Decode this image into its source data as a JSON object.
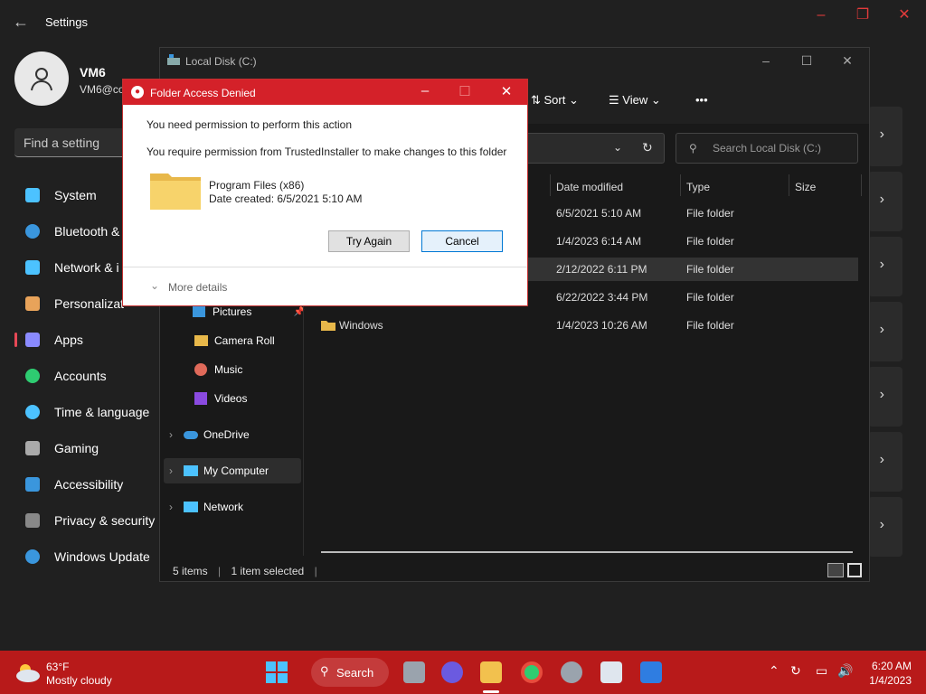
{
  "settings": {
    "title": "Settings",
    "user_name": "VM6",
    "user_email": "VM6@co",
    "search_placeholder": "Find a setting",
    "nav": [
      {
        "label": "System",
        "color": "#4cc2ff"
      },
      {
        "label": "Bluetooth &",
        "color": "#3a96dd"
      },
      {
        "label": "Network & i",
        "color": "#4cc2ff"
      },
      {
        "label": "Personalizat",
        "color": "#e8a35a"
      },
      {
        "label": "Apps",
        "color": "#8a8aff"
      },
      {
        "label": "Accounts",
        "color": "#2ecc71"
      },
      {
        "label": "Time & language",
        "color": "#4cc2ff"
      },
      {
        "label": "Gaming",
        "color": "#aaaaaa"
      },
      {
        "label": "Accessibility",
        "color": "#3a96dd"
      },
      {
        "label": "Privacy & security",
        "color": "#888888"
      },
      {
        "label": "Windows Update",
        "color": "#3a96dd"
      }
    ]
  },
  "explorer": {
    "title": "Local Disk (C:)",
    "toolbar": {
      "sort": "Sort",
      "view": "View",
      "more": "•••"
    },
    "search_placeholder": "Search Local Disk (C:)",
    "columns": [
      "Date modified",
      "Type",
      "Size"
    ],
    "rows": [
      {
        "name": "",
        "date": "6/5/2021 5:10 AM",
        "type": "File folder"
      },
      {
        "name": "",
        "date": "1/4/2023 6:14 AM",
        "type": "File folder"
      },
      {
        "name": "",
        "date": "2/12/2022 6:11 PM",
        "type": "File folder"
      },
      {
        "name": "",
        "date": "6/22/2022 3:44 PM",
        "type": "File folder"
      },
      {
        "name": "Windows",
        "date": "1/4/2023 10:26 AM",
        "type": "File folder"
      }
    ],
    "sidebar": [
      "Pictures",
      "Camera Roll",
      "Music",
      "Videos",
      "OneDrive",
      "My Computer",
      "Network"
    ],
    "status_items": "5 items",
    "status_selected": "1 item selected"
  },
  "dialog": {
    "title": "Folder Access Denied",
    "message1": "You need permission to perform this action",
    "message2": "You require permission from TrustedInstaller to make changes to this folder",
    "folder_name": "Program Files (x86)",
    "folder_date": "Date created: 6/5/2021 5:10 AM",
    "try_again": "Try Again",
    "cancel": "Cancel",
    "more_details": "More details"
  },
  "taskbar": {
    "temp": "63°F",
    "weather": "Mostly cloudy",
    "search": "Search",
    "time": "6:20 AM",
    "date": "1/4/2023"
  }
}
